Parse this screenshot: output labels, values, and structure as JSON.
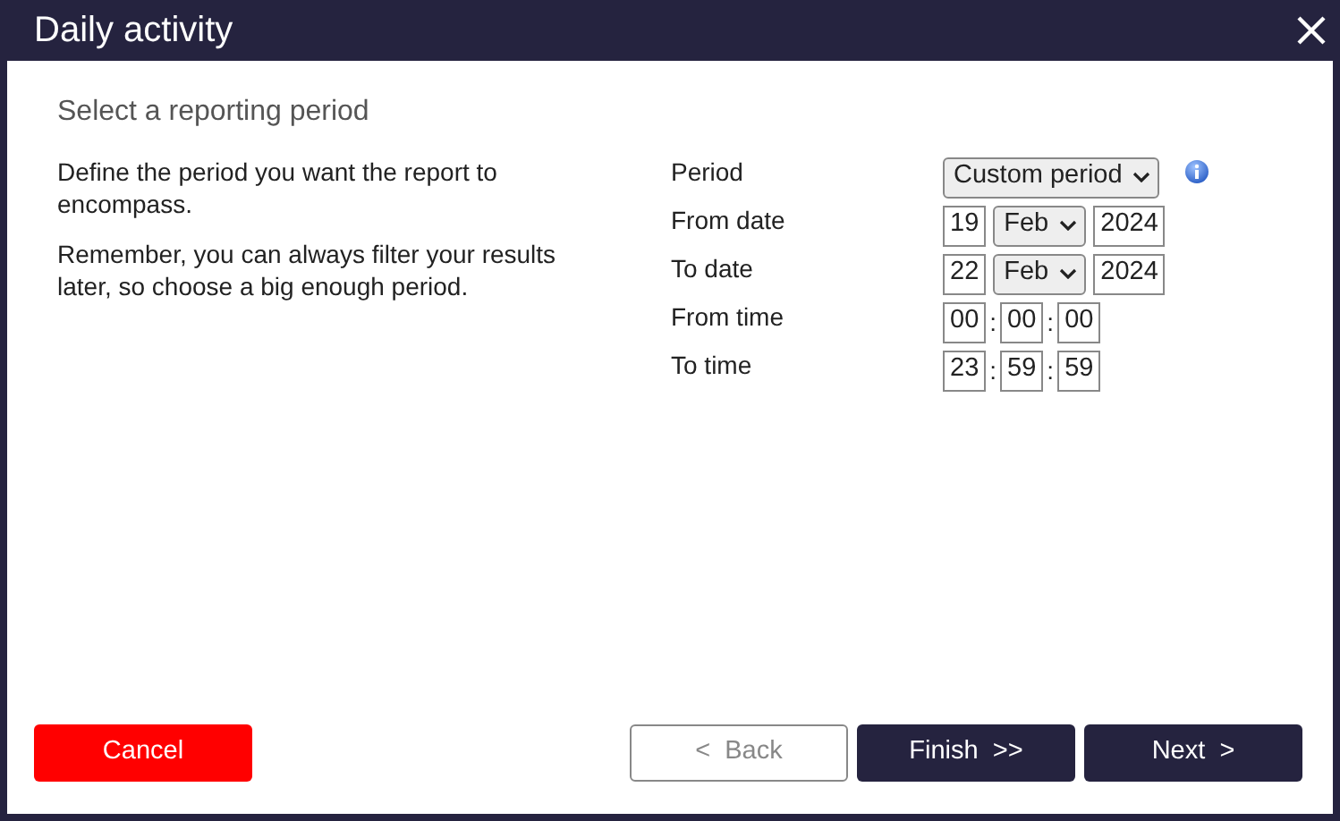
{
  "window": {
    "title": "Daily activity"
  },
  "heading": "Select a reporting period",
  "description": [
    "Define the period you want the report to encompass.",
    "Remember, you can always filter your results later, so choose a big enough period."
  ],
  "fields": [
    {
      "kind": "select",
      "label": "Period",
      "value": "Custom period",
      "info": true
    },
    {
      "kind": "date",
      "label": "From date",
      "day": "19",
      "month": "Feb",
      "year": "2024"
    },
    {
      "kind": "date",
      "label": "To date",
      "day": "22",
      "month": "Feb",
      "year": "2024"
    },
    {
      "kind": "time",
      "label": "From time",
      "parts": [
        "00",
        "00",
        "00"
      ],
      "separator": ":"
    },
    {
      "kind": "time",
      "label": "To time",
      "parts": [
        "23",
        "59",
        "59"
      ],
      "separator": ":"
    }
  ],
  "buttons": [
    {
      "kind": "danger",
      "label": "Cancel",
      "disabled": false
    },
    {
      "kind": "secondary",
      "label": "<  Back",
      "disabled": true
    },
    {
      "kind": "primary",
      "label": "Finish  >>",
      "disabled": false
    },
    {
      "kind": "primary",
      "label": "Next  >",
      "disabled": false
    }
  ]
}
